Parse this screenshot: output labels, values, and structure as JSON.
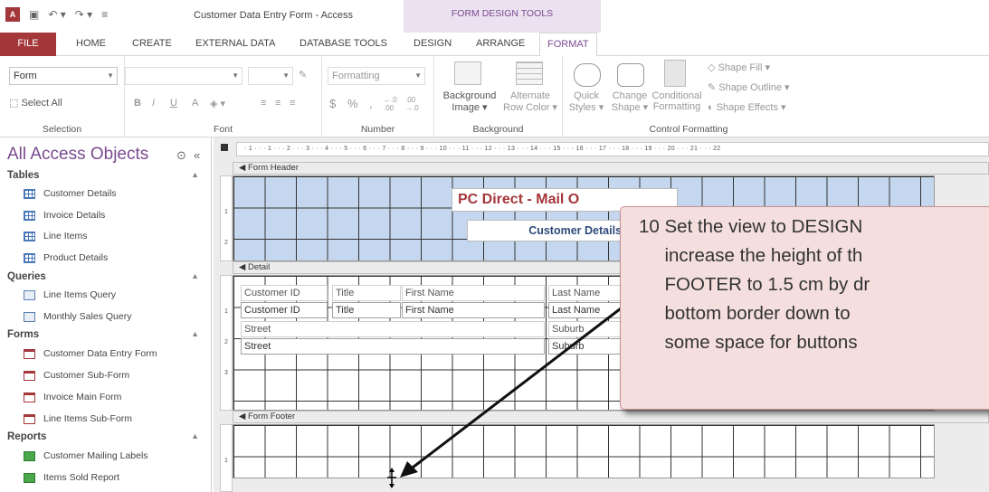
{
  "window": {
    "title": "Customer Data Entry Form - Access",
    "context_group": "FORM DESIGN TOOLS"
  },
  "tabs": [
    {
      "label": "FILE"
    },
    {
      "label": "HOME"
    },
    {
      "label": "CREATE"
    },
    {
      "label": "EXTERNAL DATA"
    },
    {
      "label": "DATABASE TOOLS"
    },
    {
      "label": "DESIGN"
    },
    {
      "label": "ARRANGE"
    },
    {
      "label": "FORMAT"
    }
  ],
  "ribbon": {
    "selection": {
      "object_combo": "Form",
      "select_all": "Select All",
      "label": "Selection"
    },
    "font": {
      "bold": "B",
      "italic": "I",
      "underline": "U",
      "font_color": "A",
      "label": "Font"
    },
    "number": {
      "format_combo": "Formatting",
      "currency": "$",
      "percent": "%",
      "comma": ",",
      "increase_decimals": "←.0 .00",
      "decrease_decimals": ".00 →.0",
      "label": "Number"
    },
    "background": {
      "image_line1": "Background",
      "image_line2": "Image ▾",
      "alt_line1": "Alternate",
      "alt_line2": "Row Color ▾",
      "label": "Background"
    },
    "control_formatting": {
      "quick_line1": "Quick",
      "quick_line2": "Styles ▾",
      "change_line1": "Change",
      "change_line2": "Shape ▾",
      "cond_line1": "Conditional",
      "cond_line2": "Formatting",
      "shape_fill": "Shape Fill ▾",
      "shape_outline": "Shape Outline ▾",
      "shape_effects": "Shape Effects ▾",
      "label": "Control Formatting"
    }
  },
  "nav": {
    "title": "All Access Objects",
    "sections": [
      {
        "label": "Tables",
        "items": [
          "Customer Details",
          "Invoice Details",
          "Line Items",
          "Product Details"
        ]
      },
      {
        "label": "Queries",
        "items": [
          "Line Items Query",
          "Monthly Sales Query"
        ]
      },
      {
        "label": "Forms",
        "items": [
          "Customer Data Entry Form",
          "Customer Sub-Form",
          "Invoice Main Form",
          "Line Items Sub-Form"
        ]
      },
      {
        "label": "Reports",
        "items": [
          "Customer Mailing Labels",
          "Items Sold Report"
        ]
      }
    ]
  },
  "design": {
    "ruler": "· 1 · · · 1 · · · 2 · · · 3 · · · 4 · · · 5 · · · 6 · · · 7 · · · 8 · · · 9 · · · 10 · · · 11 · · · 12 · · · 13 · · · 14 · · · 15 · · · 16 · · · 17 · · · 18 · · · 19 · · · 20 · · · 21 · · · 22",
    "sections": {
      "header": "Form Header",
      "detail": "Detail",
      "footer": "Form Footer"
    },
    "vruler_ticks": {
      "one": "1",
      "two": "2",
      "three": "3"
    },
    "form_title": "PC Direct - Mail O",
    "form_subtitle": "Customer Details",
    "controls": {
      "customer_id_label": "Customer ID",
      "customer_id": "Customer ID",
      "title_label": "Title",
      "title": "Title",
      "first_name_label": "First Name",
      "first_name": "First Name",
      "last_name_label": "Last Name",
      "last_name": "Last Name",
      "street_label": "Street",
      "street": "Street",
      "suburb_label": "Suburb",
      "suburb": "Suburb"
    }
  },
  "callout": {
    "text": "10 Set the view to DESIGN\n     increase the height of th\n     FOOTER to 1.5 cm by dr\n     bottom border down to\n     some space for buttons"
  }
}
